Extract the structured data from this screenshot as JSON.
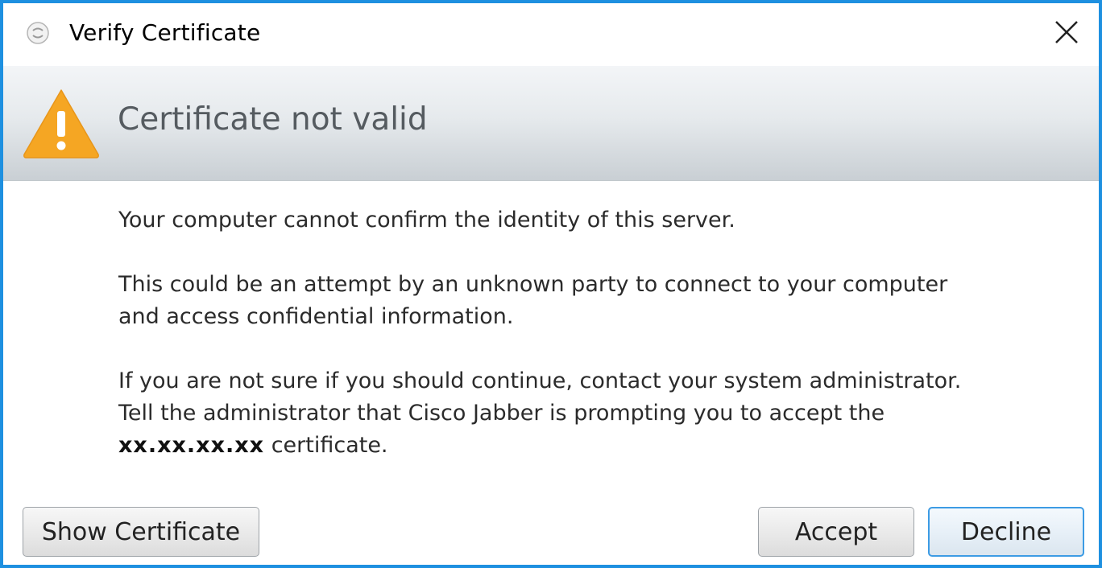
{
  "window": {
    "title": "Verify Certificate",
    "app_icon": "jabber-app-icon",
    "close_icon": "close-icon"
  },
  "header": {
    "icon": "warning-icon",
    "title": "Certificate not valid"
  },
  "message": {
    "line1": "Your computer cannot confirm the identity of this server.",
    "para2_line1": "This could be an attempt by an unknown party to connect to your computer",
    "para2_line2": "and access confidential information.",
    "para3_line1": "If you are not sure if you should continue, contact your system administrator.",
    "para3_line2": "Tell the administrator that Cisco Jabber is prompting you to accept the",
    "cert_host": "xx.xx.xx.xx",
    "para3_tail": " certificate."
  },
  "buttons": {
    "show_certificate": "Show Certificate",
    "accept": "Accept",
    "decline": "Decline"
  },
  "colors": {
    "window_border": "#1e90e0",
    "warning": "#f5a623",
    "default_button_border": "#3c9be4"
  }
}
